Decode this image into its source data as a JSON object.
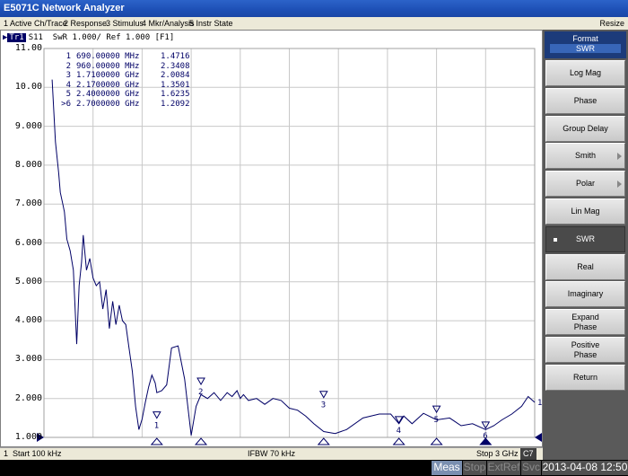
{
  "window": {
    "title": "E5071C Network Analyzer",
    "resize": "Resize"
  },
  "menu": [
    "1 Active Ch/Trace",
    "2 Response",
    "3 Stimulus",
    "4 Mkr/Analysis",
    "5 Instr State"
  ],
  "trace": {
    "tag": "Tr1",
    "info": "S11  SwR 1.000/ Ref 1.000 [F1]"
  },
  "chart_data": {
    "type": "line",
    "xlabel": "",
    "ylabel": "",
    "xlim_ghz": [
      0.0001,
      3.0
    ],
    "ylim": [
      1.0,
      11.0
    ],
    "y_ticks": [
      "11.00",
      "10.00",
      "9.000",
      "8.000",
      "7.000",
      "6.000",
      "5.000",
      "4.000",
      "3.000",
      "2.000",
      "1.000"
    ],
    "series": [
      {
        "x": [
          0.05,
          0.07,
          0.09,
          0.1,
          0.115,
          0.125,
          0.14,
          0.16,
          0.18,
          0.2,
          0.215,
          0.23,
          0.24,
          0.26,
          0.28,
          0.3,
          0.32,
          0.34,
          0.36,
          0.38,
          0.4,
          0.42,
          0.44,
          0.46,
          0.48,
          0.5,
          0.52,
          0.54,
          0.56,
          0.58,
          0.6,
          0.62,
          0.64,
          0.66,
          0.68,
          0.69,
          0.72,
          0.75,
          0.78,
          0.82,
          0.86,
          0.9,
          0.93,
          0.96,
          1.0,
          1.04,
          1.08,
          1.12,
          1.15,
          1.18,
          1.2,
          1.22,
          1.25,
          1.3,
          1.35,
          1.4,
          1.45,
          1.5,
          1.55,
          1.6,
          1.65,
          1.71,
          1.78,
          1.85,
          1.95,
          2.05,
          2.12,
          2.17,
          2.2,
          2.25,
          2.32,
          2.4,
          2.48,
          2.55,
          2.62,
          2.7,
          2.75,
          2.8,
          2.86,
          2.92,
          2.96,
          3.0
        ],
        "y": [
          10.2,
          8.6,
          7.8,
          7.3,
          7.0,
          6.8,
          6.1,
          5.8,
          5.3,
          3.4,
          4.9,
          5.5,
          6.2,
          5.3,
          5.6,
          5.1,
          4.9,
          5.0,
          4.3,
          4.8,
          3.8,
          4.5,
          3.9,
          4.4,
          4.0,
          3.9,
          3.3,
          2.7,
          1.8,
          1.2,
          1.47,
          1.9,
          2.3,
          2.6,
          2.4,
          2.15,
          2.2,
          2.35,
          3.3,
          3.35,
          2.5,
          1.05,
          1.8,
          2.1,
          2.0,
          2.15,
          1.95,
          2.15,
          2.05,
          2.2,
          2.0,
          2.1,
          1.95,
          2.0,
          1.85,
          2.0,
          1.95,
          1.75,
          1.7,
          1.55,
          1.35,
          1.15,
          1.1,
          1.2,
          1.5,
          1.6,
          1.6,
          1.35,
          1.55,
          1.35,
          1.62,
          1.45,
          1.5,
          1.3,
          1.35,
          1.2,
          1.3,
          1.45,
          1.6,
          1.8,
          2.05,
          1.9
        ]
      }
    ],
    "markers": [
      {
        "n": "1",
        "freq": "690.00000 MHz",
        "val": "1.4716",
        "x": 0.69,
        "y": 1.47
      },
      {
        "n": "2",
        "freq": "960.00000 MHz",
        "val": "2.3408",
        "x": 0.96,
        "y": 2.34
      },
      {
        "n": "3",
        "freq": "1.7100000 GHz",
        "val": "2.0084",
        "x": 1.71,
        "y": 2.0
      },
      {
        "n": "4",
        "freq": "2.1700000 GHz",
        "val": "1.3501",
        "x": 2.17,
        "y": 1.35
      },
      {
        "n": "5",
        "freq": "2.4000000 GHz",
        "val": "1.6235",
        "x": 2.4,
        "y": 1.62
      },
      {
        "n": ">6",
        "freq": "2.7000000 GHz",
        "val": "1.2092",
        "x": 2.7,
        "y": 1.21
      }
    ]
  },
  "status": {
    "ch": "1",
    "start": "Start 100 kHz",
    "ifbw": "IFBW 70 kHz",
    "stop": "Stop 3 GHz",
    "c7": "C7"
  },
  "bottom": {
    "meas": "Meas",
    "stop": "Stop",
    "extref": "ExtRef",
    "svc": "Svc",
    "datetime": "2013-04-08 12:50"
  },
  "softkeys": {
    "title": "Format",
    "subtitle": "SWR",
    "items": [
      "Log Mag",
      "Phase",
      "Group Delay",
      "Smith",
      "Polar",
      "Lin Mag",
      "SWR",
      "Real",
      "Imaginary",
      "Expand\nPhase",
      "Positive\nPhase",
      "Return"
    ]
  },
  "colors": {
    "trace": "#000066",
    "grid": "#c8c8c8",
    "active_key": "#4a4a4a",
    "title_bg": "#1d4fb5"
  }
}
